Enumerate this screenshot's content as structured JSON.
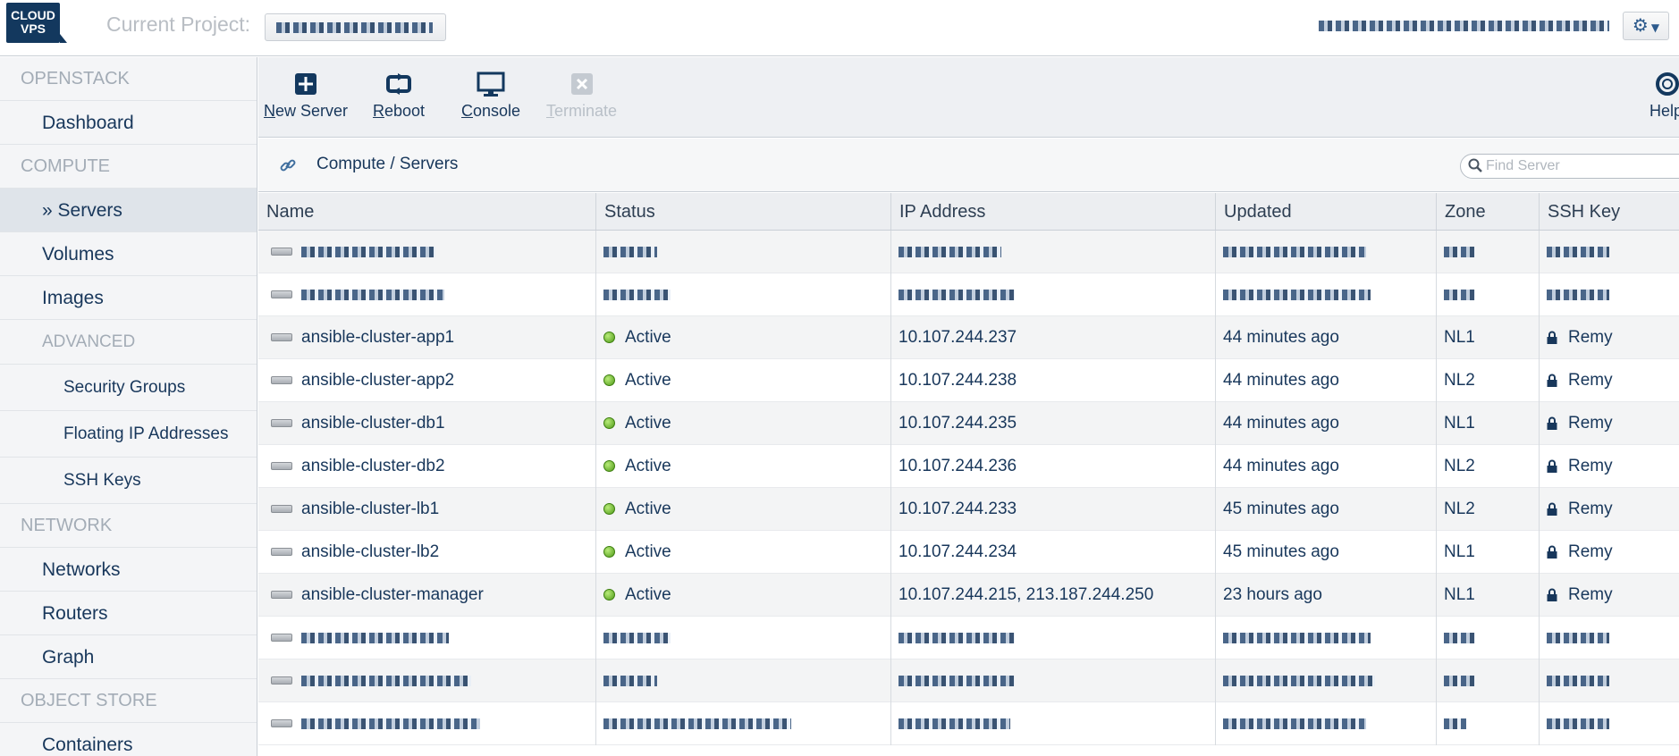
{
  "topbar": {
    "logo_line1": "CLOUD",
    "logo_line2": "VPS",
    "project_label": "Current Project:",
    "settings_icon": "gear-icon"
  },
  "sidebar": {
    "sections": {
      "openstack": "OPENSTACK",
      "compute": "COMPUTE",
      "advanced": "ADVANCED",
      "network": "NETWORK",
      "object_store": "OBJECT STORE"
    },
    "items": {
      "dashboard": "Dashboard",
      "servers": "» Servers",
      "volumes": "Volumes",
      "images": "Images",
      "security_groups": "Security Groups",
      "floating_ips": "Floating IP Addresses",
      "ssh_keys": "SSH Keys",
      "networks": "Networks",
      "routers": "Routers",
      "graph": "Graph",
      "containers": "Containers"
    }
  },
  "toolbar": {
    "new_server": {
      "first": "N",
      "rest": "ew Server"
    },
    "reboot": {
      "first": "R",
      "rest": "eboot"
    },
    "console": {
      "first": "C",
      "rest": "onsole"
    },
    "terminate": {
      "first": "T",
      "rest": "erminate"
    },
    "help": "Help"
  },
  "breadcrumb": {
    "text": "Compute / Servers"
  },
  "search": {
    "placeholder": "Find Server"
  },
  "table": {
    "headers": [
      "Name",
      "Status",
      "IP Address",
      "Updated",
      "Zone",
      "SSH Key"
    ],
    "rows": [
      {
        "name": "ansible-cluster-app1",
        "status": "Active",
        "ip": "10.107.244.237",
        "updated": "44 minutes ago",
        "zone": "NL1",
        "ssh_key": "Remy"
      },
      {
        "name": "ansible-cluster-app2",
        "status": "Active",
        "ip": "10.107.244.238",
        "updated": "44 minutes ago",
        "zone": "NL2",
        "ssh_key": "Remy"
      },
      {
        "name": "ansible-cluster-db1",
        "status": "Active",
        "ip": "10.107.244.235",
        "updated": "44 minutes ago",
        "zone": "NL1",
        "ssh_key": "Remy"
      },
      {
        "name": "ansible-cluster-db2",
        "status": "Active",
        "ip": "10.107.244.236",
        "updated": "44 minutes ago",
        "zone": "NL2",
        "ssh_key": "Remy"
      },
      {
        "name": "ansible-cluster-lb1",
        "status": "Active",
        "ip": "10.107.244.233",
        "updated": "45 minutes ago",
        "zone": "NL2",
        "ssh_key": "Remy"
      },
      {
        "name": "ansible-cluster-lb2",
        "status": "Active",
        "ip": "10.107.244.234",
        "updated": "45 minutes ago",
        "zone": "NL1",
        "ssh_key": "Remy"
      },
      {
        "name": "ansible-cluster-manager",
        "status": "Active",
        "ip": "10.107.244.215, 213.187.244.250",
        "updated": "23 hours ago",
        "zone": "NL1",
        "ssh_key": "Remy"
      }
    ]
  },
  "colors": {
    "brand": "#13385e",
    "text": "#18375b",
    "active_status": "#5aa81f"
  }
}
